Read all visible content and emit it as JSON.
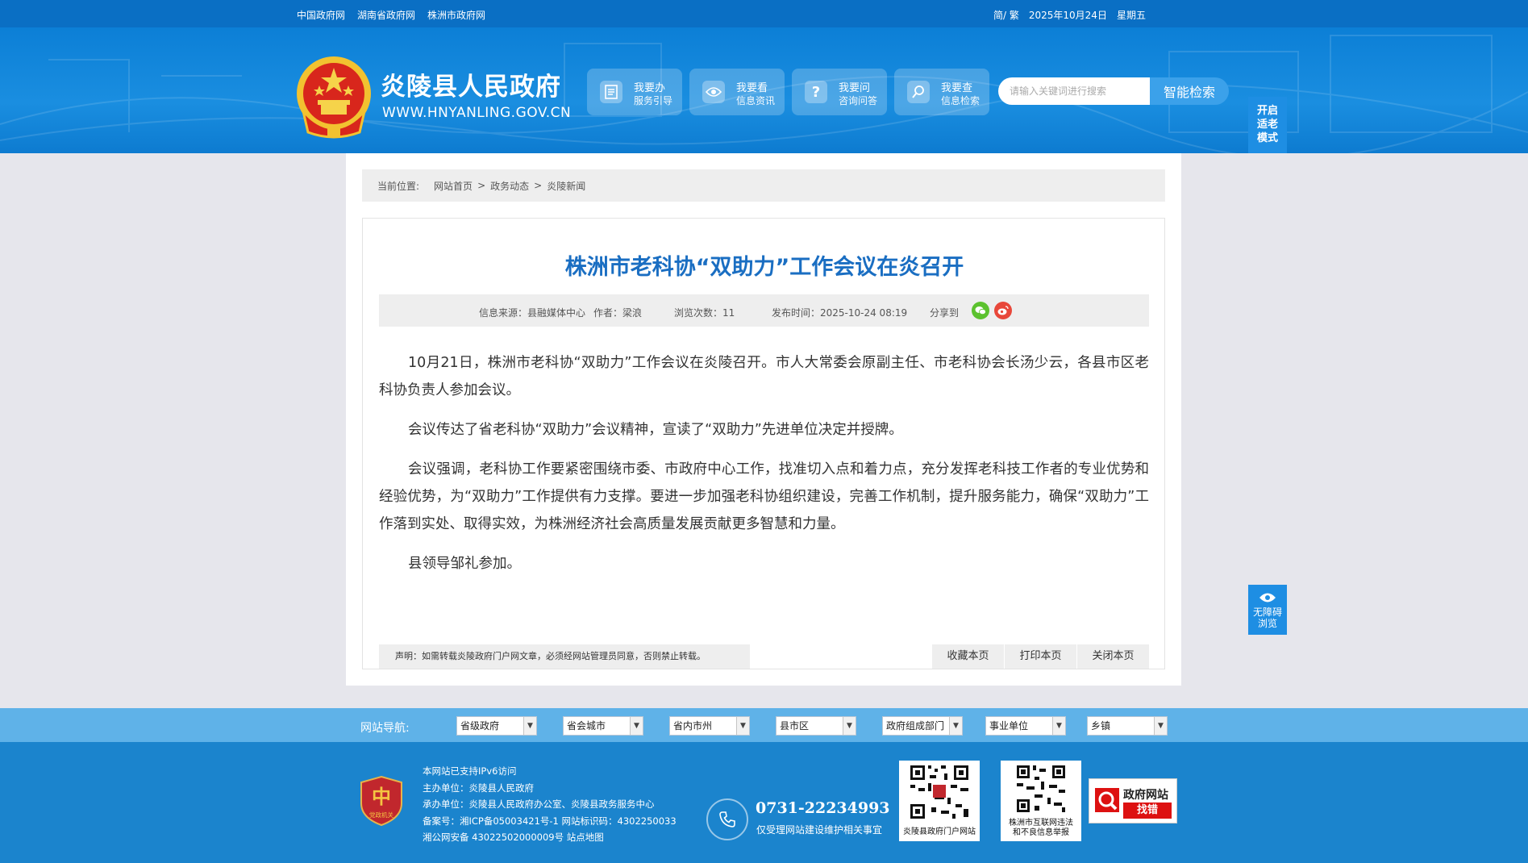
{
  "topbar": {
    "links": [
      "中国政府网",
      "湖南省政府网",
      "株洲市政府网"
    ],
    "lang": "简/ 繁",
    "date": "2025年10月24日",
    "weekday": "星期五"
  },
  "header": {
    "title": "炎陵县人民政府",
    "url": "WWW.HNYANLING.GOV.CN",
    "quick": [
      {
        "l1": "我要办",
        "l2": "服务引导",
        "icon": "document-icon"
      },
      {
        "l1": "我要看",
        "l2": "信息资讯",
        "icon": "eye-icon"
      },
      {
        "l1": "我要问",
        "l2": "咨询问答",
        "icon": "question-icon"
      },
      {
        "l1": "我要查",
        "l2": "信息检索",
        "icon": "search-icon"
      }
    ],
    "search_placeholder": "请输入关键词进行搜索",
    "search_button": "智能检索",
    "elder_mode": [
      "开启",
      "适老",
      "模式"
    ]
  },
  "breadcrumb": {
    "prefix": "当前位置:",
    "items": [
      "网站首页",
      "政务动态",
      "炎陵新闻"
    ]
  },
  "article": {
    "title": "株洲市老科协“双助力”工作会议在炎召开",
    "source": "信息来源：县融媒体中心",
    "author": "作者：梁浪",
    "views": "浏览次数：11",
    "published": "发布时间：2025-10-24 08:19",
    "share_label": "分享到",
    "paragraphs": [
      "10月21日，株洲市老科协“双助力”工作会议在炎陵召开。市人大常委会原副主任、市老科协会长汤少云，各县市区老科协负责人参加会议。",
      "会议传达了省老科协“双助力”会议精神，宣读了“双助力”先进单位决定并授牌。",
      "会议强调，老科协工作要紧密围绕市委、市政府中心工作，找准切入点和着力点，充分发挥老科技工作者的专业优势和经验优势，为“双助力”工作提供有力支撑。要进一步加强老科协组织建设，完善工作机制，提升服务能力，确保“双助力”工作落到实处、取得实效，为株洲经济社会高质量发展贡献更多智慧和力量。",
      "县领导邹礼参加。"
    ],
    "notice": "声明：如需转载炎陵政府门户网文章，必须经网站管理员同意，否则禁止转载。",
    "buttons": [
      "收藏本页",
      "打印本页",
      "关闭本页"
    ]
  },
  "accessibility": [
    "无障碍",
    "浏览"
  ],
  "site_nav": {
    "label": "网站导航:",
    "selects": [
      "省级政府",
      "省会城市",
      "省内市州",
      "县市区",
      "政府组成部门",
      "事业单位",
      "乡镇"
    ]
  },
  "footer": {
    "info": [
      "本网站已支持IPv6访问",
      "主办单位：炎陵县人民政府",
      "承办单位：炎陵县人民政府办公室、炎陵县政务服务中心",
      "备案号：湘ICP备05003421号-1 网站标识码：4302250033",
      "湘公网安备 43022502000009号 站点地图"
    ],
    "badge_text": "党政机关",
    "phone": "0731-22234993",
    "phone_note": "仅受理网站建设维护相关事宜",
    "qr1_caption": "炎陵县政府门户网站",
    "qr2_caption": [
      "株洲市互联网违法",
      "和不良信息举报"
    ],
    "findbug": [
      "政府网站",
      "找错"
    ]
  }
}
